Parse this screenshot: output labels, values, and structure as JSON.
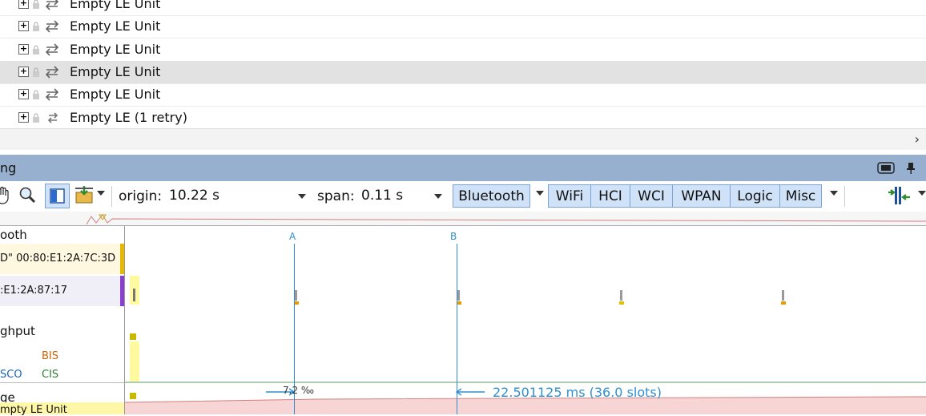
{
  "packet_list": {
    "rows": [
      {
        "label": "Empty LE Unit",
        "selected": false
      },
      {
        "label": "Empty LE Unit",
        "selected": false
      },
      {
        "label": "Empty LE Unit",
        "selected": false
      },
      {
        "label": "Empty LE Unit",
        "selected": true
      },
      {
        "label": "Empty LE Unit",
        "selected": false
      },
      {
        "label": "Empty LE (1 retry)",
        "selected": false
      }
    ],
    "expand_symbol": "+"
  },
  "panel": {
    "title": "ng"
  },
  "toolbar": {
    "origin_label": "origin:",
    "origin_value": "10.22 s",
    "span_label": "span:",
    "span_value": "0.11 s",
    "filters": [
      "Bluetooth",
      "WiFi",
      "HCI",
      "WCI",
      "WPAN",
      "Logic",
      "Misc"
    ]
  },
  "lanes": {
    "labels": {
      "bluetooth": "ooth",
      "device1": "D\" 00:80:E1:2A:7C:3D",
      "device2": ":E1:2A:87:17",
      "throughput": "ghput",
      "bis": "BIS",
      "cis": "CIS",
      "sco": "SCO",
      "range": "ge",
      "empty": "mpty LE Unit"
    },
    "colors": {
      "device1_marker": "#e8b800",
      "device2_marker": "#8a3fd1",
      "bis": "#c8650a",
      "cis": "#2e7d32",
      "sco": "#1565c0"
    }
  },
  "timeline": {
    "cursor_a": "A",
    "cursor_b": "B",
    "annotation_left": "7.2 ‰",
    "annotation_right": "22.501125 ms  (36.0 slots)",
    "accent": "#2f8fd0"
  }
}
